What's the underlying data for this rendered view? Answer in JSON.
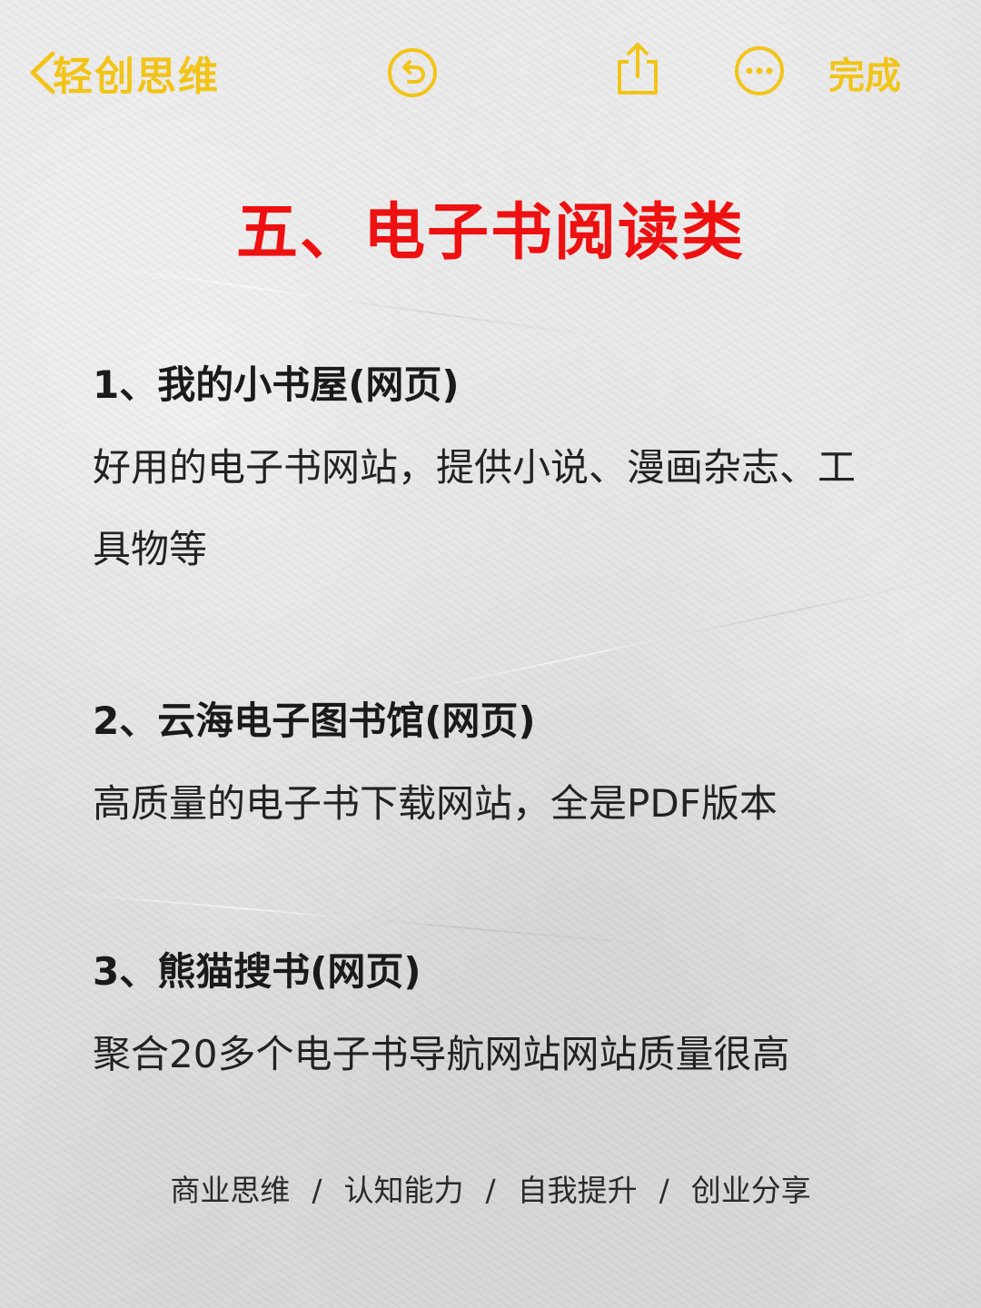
{
  "nav": {
    "back_label": "轻创思维",
    "done_label": "完成",
    "accent_color": "#f2c418",
    "icons": [
      "chevron-left-icon",
      "undo-icon",
      "share-icon",
      "more-icon"
    ]
  },
  "note": {
    "title": "五、电子书阅读类",
    "title_color": "#ee1111",
    "sections": [
      {
        "heading": "1、我的小书屋(网页)",
        "desc": "好用的电子书网站，提供小说、漫画杂志、工具物等"
      },
      {
        "heading": "2、云海电子图书馆(网页)",
        "desc": "高质量的电子书下载网站，全是PDF版本"
      },
      {
        "heading": "3、熊猫搜书(网页)",
        "desc": "聚合20多个电子书导航网站网站质量很高"
      }
    ]
  },
  "footer": {
    "tags": [
      "商业思维",
      "认知能力",
      "自我提升",
      "创业分享"
    ],
    "separator": "/"
  }
}
